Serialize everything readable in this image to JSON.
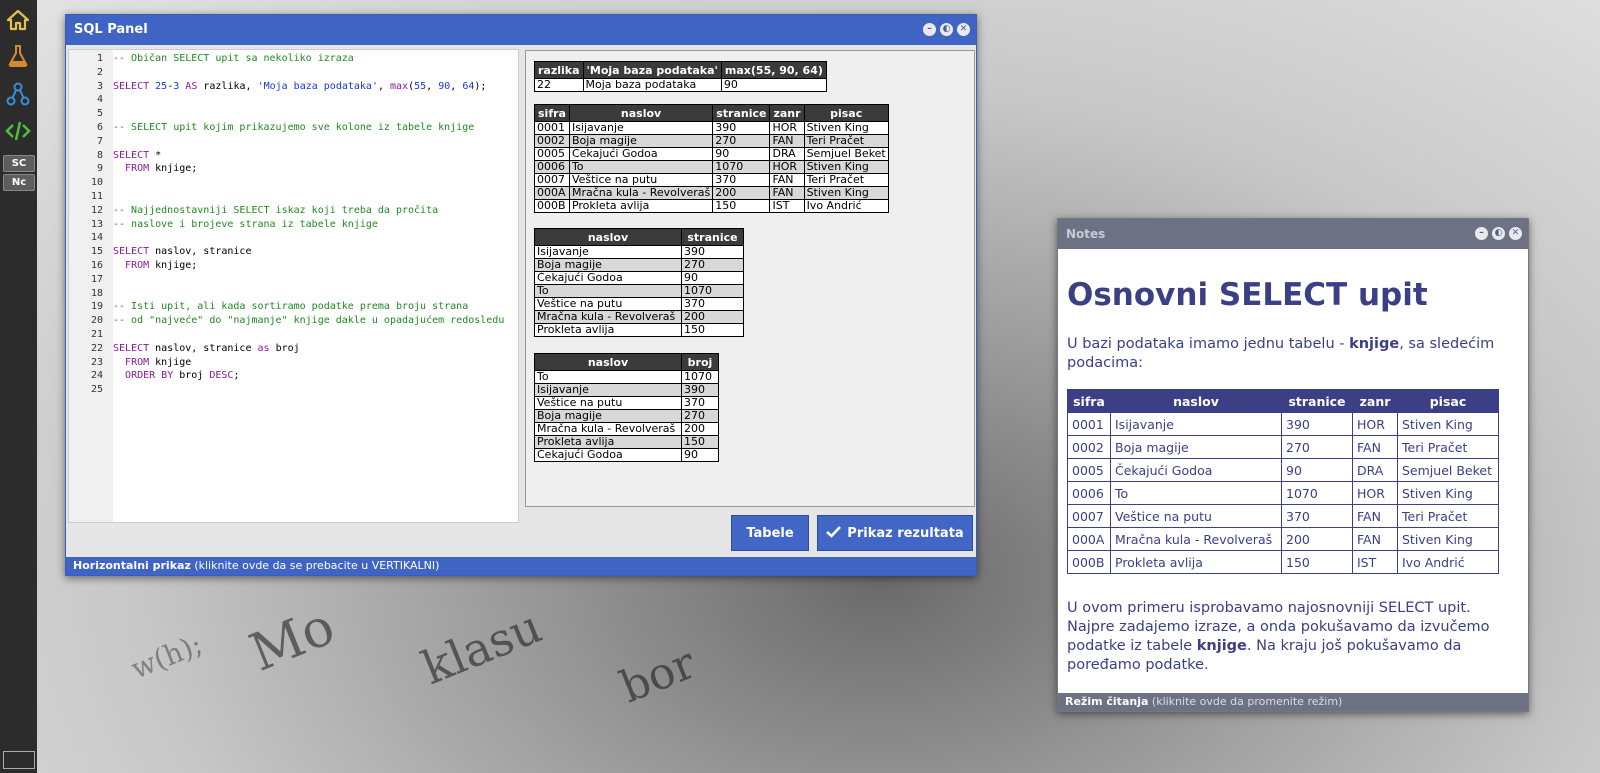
{
  "sidebar": {
    "tags": [
      "SC",
      "Nc"
    ]
  },
  "sql_panel": {
    "title": "SQL Panel",
    "buttons": {
      "tables": "Tabele",
      "run": "Prikaz rezultata"
    },
    "status_bold": "Horizontalni prikaz",
    "status_rest": " (kliknite ovde da se prebacite u VERTIKALNI)",
    "code_lines": [
      "-- Običan SELECT upit sa nekoliko izraza",
      "",
      "SELECT 25-3 AS razlika, 'Moja baza podataka', max(55, 90, 64);",
      "",
      "",
      "-- SELECT upit kojim prikazujemo sve kolone iz tabele knjige",
      "",
      "SELECT *",
      "  FROM knjige;",
      "",
      "",
      "-- Najjednostavniji SELECT iskaz koji treba da pročita",
      "-- naslove i brojeve strana iz tabele knjige",
      "",
      "SELECT naslov, stranice",
      "  FROM knjige;",
      "",
      "",
      "-- Isti upit, ali kada sortiramo podatke prema broju strana",
      "-- od \"najveće\" do \"najmanje\" knjige dakle u opadajućem redosledu",
      "",
      "SELECT naslov, stranice as broj",
      "  FROM knjige",
      "  ORDER BY broj DESC;",
      ""
    ],
    "result1": {
      "headers": [
        "razlika",
        "'Moja baza podataka'",
        "max(55, 90, 64)"
      ],
      "rows": [
        [
          "22",
          "Moja baza podataka",
          "90"
        ]
      ]
    },
    "result2": {
      "headers": [
        "sifra",
        "naslov",
        "stranice",
        "zanr",
        "pisac"
      ],
      "rows": [
        [
          "0001",
          "Isijavanje",
          "390",
          "HOR",
          "Stiven King"
        ],
        [
          "0002",
          "Boja magije",
          "270",
          "FAN",
          "Teri Pračet"
        ],
        [
          "0005",
          "Čekajući Godoa",
          "90",
          "DRA",
          "Semjuel Beket"
        ],
        [
          "0006",
          "To",
          "1070",
          "HOR",
          "Stiven King"
        ],
        [
          "0007",
          "Veštice na putu",
          "370",
          "FAN",
          "Teri Pračet"
        ],
        [
          "000A",
          "Mračna kula - Revolveraš",
          "200",
          "FAN",
          "Stiven King"
        ],
        [
          "000B",
          "Prokleta avlija",
          "150",
          "IST",
          "Ivo Andrić"
        ]
      ]
    },
    "result3": {
      "headers": [
        "naslov",
        "stranice"
      ],
      "rows": [
        [
          "Isijavanje",
          "390"
        ],
        [
          "Boja magije",
          "270"
        ],
        [
          "Čekajući Godoa",
          "90"
        ],
        [
          "To",
          "1070"
        ],
        [
          "Veštice na putu",
          "370"
        ],
        [
          "Mračna kula - Revolveraš",
          "200"
        ],
        [
          "Prokleta avlija",
          "150"
        ]
      ]
    },
    "result4": {
      "headers": [
        "naslov",
        "broj"
      ],
      "rows": [
        [
          "To",
          "1070"
        ],
        [
          "Isijavanje",
          "390"
        ],
        [
          "Veštice na putu",
          "370"
        ],
        [
          "Boja magije",
          "270"
        ],
        [
          "Mračna kula - Revolveraš",
          "200"
        ],
        [
          "Prokleta avlija",
          "150"
        ],
        [
          "Čekajući Godoa",
          "90"
        ]
      ]
    }
  },
  "notes": {
    "title": "Notes",
    "heading": "Osnovni SELECT upit",
    "intro_a": "U bazi podataka imamo jednu tabelu - ",
    "intro_b": "knjige",
    "intro_c": ", sa sledećim podacima:",
    "table": {
      "headers": [
        "sifra",
        "naslov",
        "stranice",
        "zanr",
        "pisac"
      ],
      "rows": [
        [
          "0001",
          "Isijavanje",
          "390",
          "HOR",
          "Stiven King"
        ],
        [
          "0002",
          "Boja magije",
          "270",
          "FAN",
          "Teri Pračet"
        ],
        [
          "0005",
          "Čekajući Godoa",
          "90",
          "DRA",
          "Semjuel Beket"
        ],
        [
          "0006",
          "To",
          "1070",
          "HOR",
          "Stiven King"
        ],
        [
          "0007",
          "Veštice na putu",
          "370",
          "FAN",
          "Teri Pračet"
        ],
        [
          "000A",
          "Mračna kula - Revolveraš",
          "200",
          "FAN",
          "Stiven King"
        ],
        [
          "000B",
          "Prokleta avlija",
          "150",
          "IST",
          "Ivo Andrić"
        ]
      ]
    },
    "outro_a": "U ovom primeru isprobavamo najosnovniji SELECT upit. Najpre zadajemo izraze, a onda pokušavamo da izvučemo podatke iz tabele ",
    "outro_b": "knjige",
    "outro_c": ". Na kraju još pokušavamo da poređamo podatke.",
    "status_bold": "Režim čitanja",
    "status_rest": " (kliknite ovde da promenite režim)"
  },
  "icons": [
    "home-icon",
    "flask-icon",
    "share-nodes-icon",
    "code-icon",
    "check-icon",
    "minimize-icon",
    "restore-icon",
    "close-icon"
  ],
  "colors": {
    "panel_blue": "#4064c4",
    "notes_gray": "#6d7184",
    "notes_text": "#3a3f86"
  }
}
